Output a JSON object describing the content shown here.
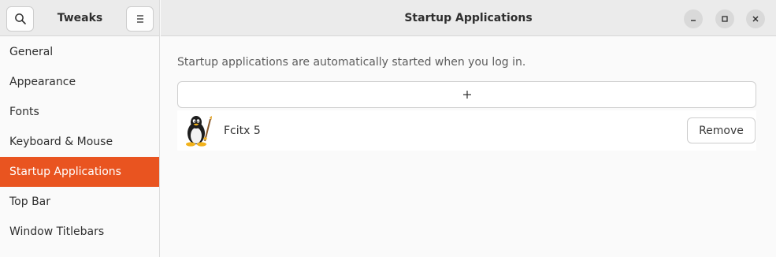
{
  "sidebar": {
    "title": "Tweaks",
    "search_icon": "search-icon",
    "menu_icon": "hamburger-menu-icon",
    "items": [
      {
        "label": "General"
      },
      {
        "label": "Appearance"
      },
      {
        "label": "Fonts"
      },
      {
        "label": "Keyboard & Mouse"
      },
      {
        "label": "Startup Applications",
        "selected": true
      },
      {
        "label": "Top Bar"
      },
      {
        "label": "Window Titlebars"
      }
    ]
  },
  "header": {
    "title": "Startup Applications",
    "controls": [
      "minimize-icon",
      "maximize-icon",
      "close-icon"
    ]
  },
  "main": {
    "description": "Startup applications are automatically started when you log in.",
    "add_icon": "plus-icon",
    "apps": [
      {
        "name": "Fcitx 5",
        "icon": "tux-penguin-icon",
        "remove_label": "Remove"
      }
    ]
  },
  "colors": {
    "accent": "#e95420",
    "header_bg": "#ebebeb",
    "content_bg": "#fafafa"
  }
}
